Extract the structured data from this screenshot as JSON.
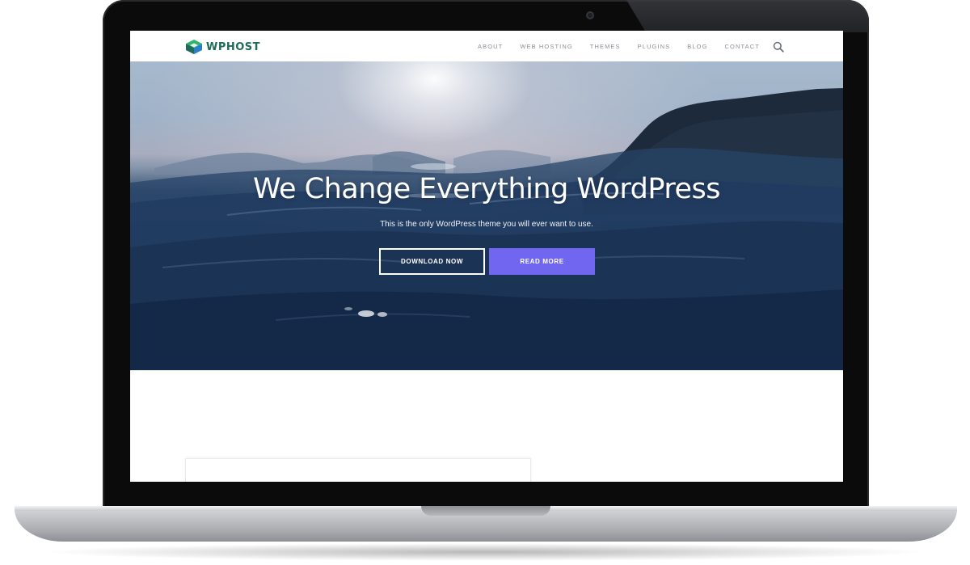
{
  "brand": {
    "name": "WPHOST",
    "colors": {
      "logo_dark": "#1f6b5a",
      "logo_green": "#2fb36b",
      "logo_blue": "#2a7fc9",
      "accent": "#7066f0"
    }
  },
  "nav": {
    "items": [
      {
        "label": "ABOUT"
      },
      {
        "label": "WEB HOSTING"
      },
      {
        "label": "THEMES"
      },
      {
        "label": "PLUGINS"
      },
      {
        "label": "BLOG"
      },
      {
        "label": "CONTACT"
      }
    ],
    "search_icon": "search-icon"
  },
  "hero": {
    "title": "We Change Everything WordPress",
    "subtitle": "This is the only WordPress theme you will ever want to use.",
    "buttons": {
      "download": "DOWNLOAD NOW",
      "read_more": "READ MORE"
    }
  }
}
